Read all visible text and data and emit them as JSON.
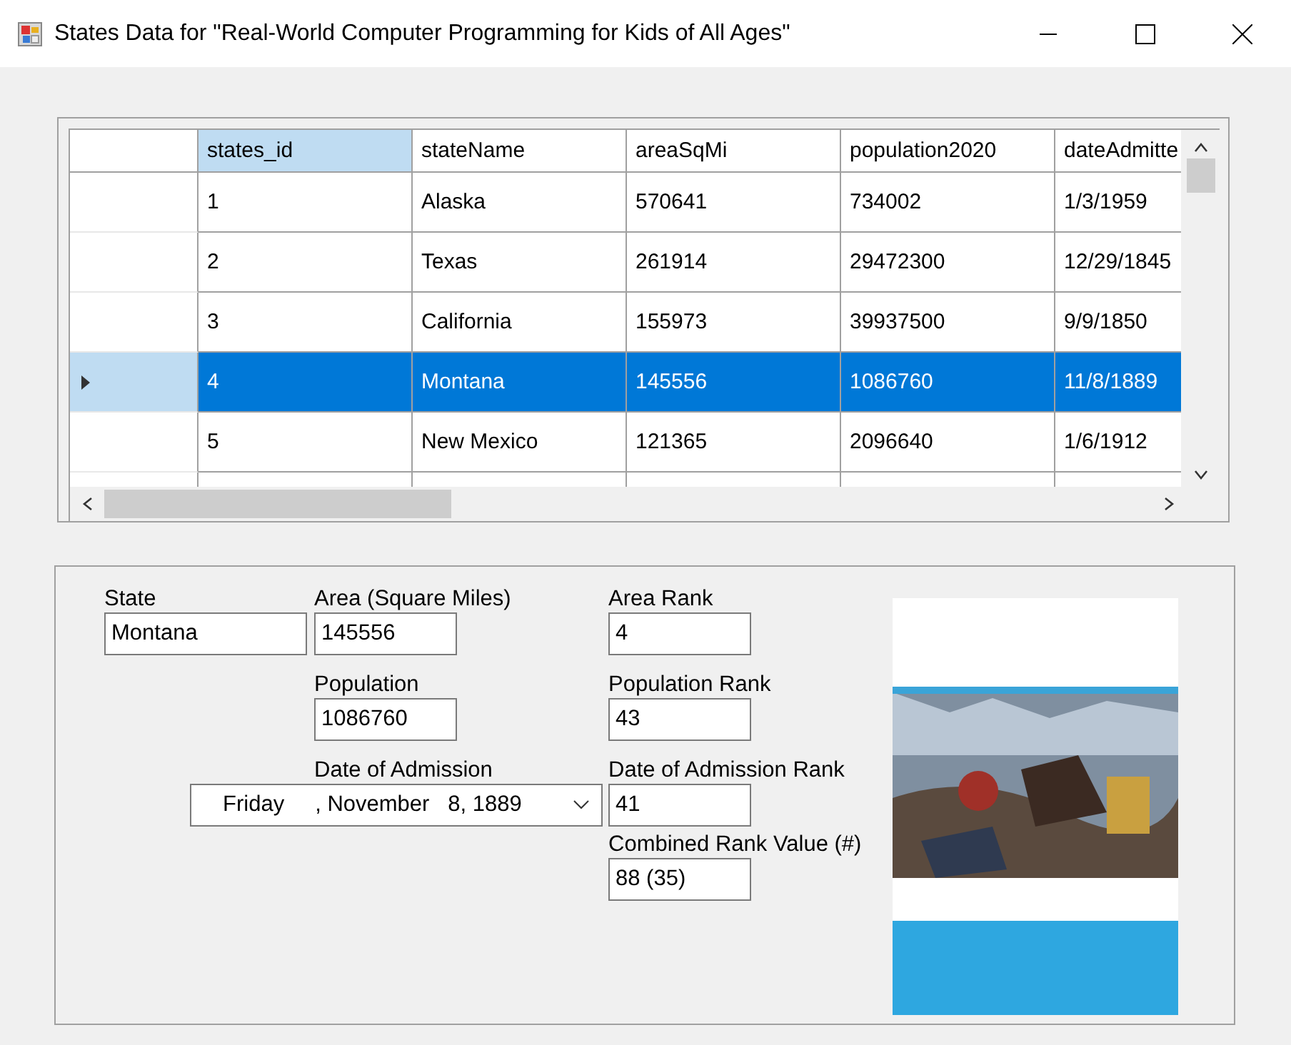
{
  "window": {
    "title": "States Data for \"Real-World Computer Programming for Kids of All Ages\""
  },
  "table": {
    "columns": [
      {
        "label": "states_id",
        "selected": true
      },
      {
        "label": "stateName",
        "selected": false
      },
      {
        "label": "areaSqMi",
        "selected": false
      },
      {
        "label": "population2020",
        "selected": false
      },
      {
        "label": "dateAdmitte",
        "selected": false
      }
    ],
    "rows": [
      {
        "cells": [
          "1",
          "Alaska",
          "570641",
          "734002",
          "1/3/1959"
        ],
        "selected": false
      },
      {
        "cells": [
          "2",
          "Texas",
          "261914",
          "29472300",
          "12/29/1845"
        ],
        "selected": false
      },
      {
        "cells": [
          "3",
          "California",
          "155973",
          "39937500",
          "9/9/1850"
        ],
        "selected": false
      },
      {
        "cells": [
          "4",
          "Montana",
          "145556",
          "1086760",
          "11/8/1889"
        ],
        "selected": true
      },
      {
        "cells": [
          "5",
          "New Mexico",
          "121365",
          "2096640",
          "1/6/1912"
        ],
        "selected": false
      }
    ]
  },
  "details": {
    "fields": [
      {
        "kind": "text",
        "label": "State",
        "value": "Montana"
      },
      {
        "kind": "text",
        "label": "Area (Square Miles)",
        "value": "145556"
      },
      {
        "kind": "text",
        "label": "Area Rank",
        "value": "4"
      },
      {
        "kind": "text",
        "label": "Population",
        "value": "1086760"
      },
      {
        "kind": "text",
        "label": "Population Rank",
        "value": "43"
      },
      {
        "kind": "date",
        "label": "Date of Admission",
        "value": "Friday     , November   8, 1889"
      },
      {
        "kind": "text",
        "label": "Date of Admission Rank",
        "value": "41"
      },
      {
        "kind": "text",
        "label": "Combined Rank Value (#)",
        "value": "88 (35)"
      }
    ]
  }
}
